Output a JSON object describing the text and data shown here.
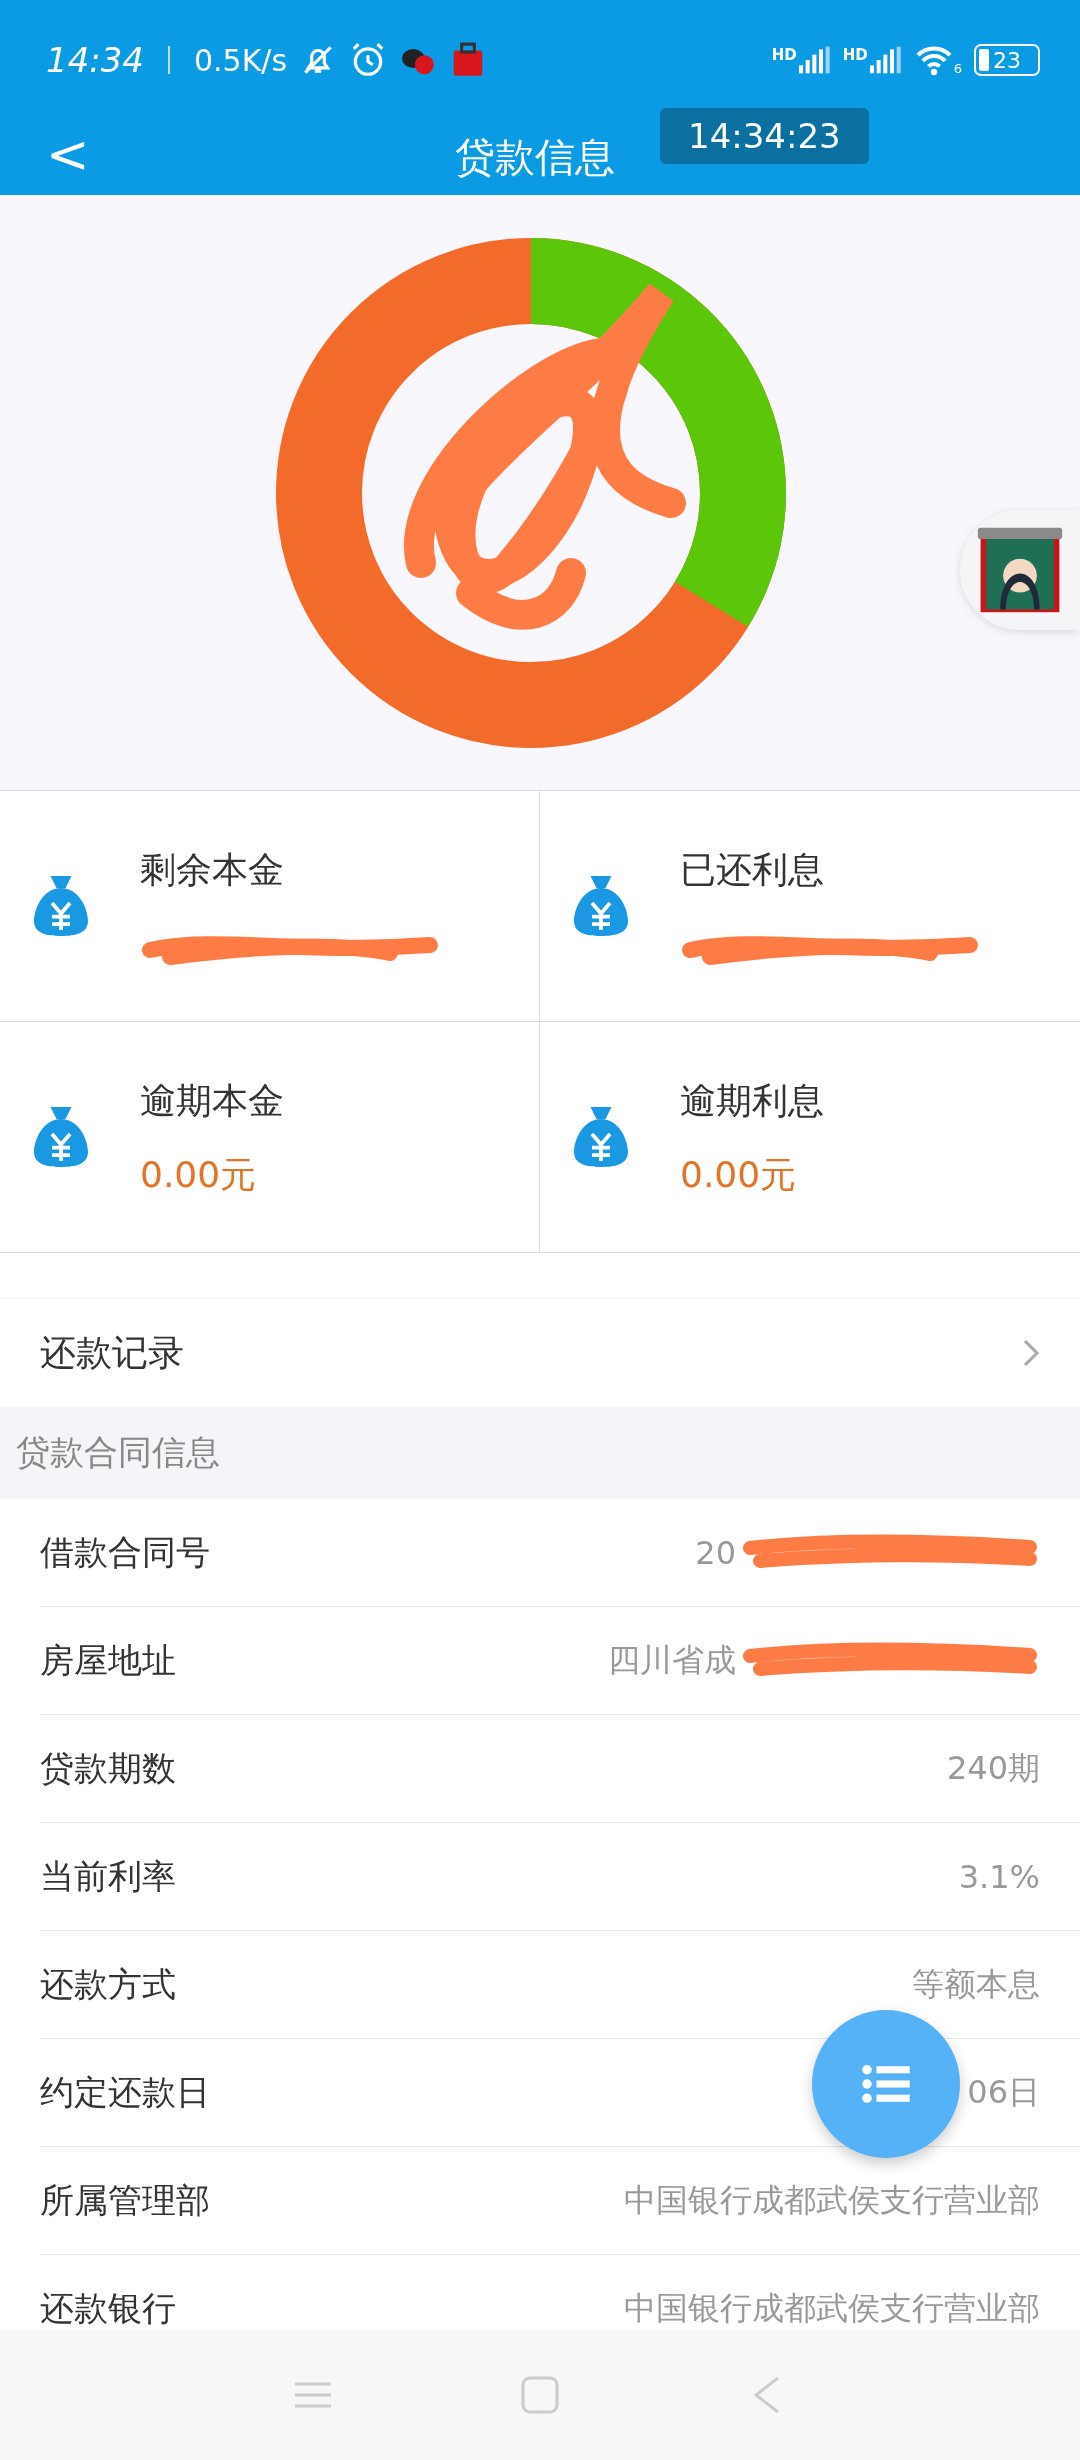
{
  "status_bar": {
    "time": "14:34",
    "speed": "0.5K/s",
    "sim_labels": [
      "HD",
      "HD"
    ],
    "wifi_label": "6",
    "battery": "23"
  },
  "recorder_time": "14:34:23",
  "nav": {
    "back": "<",
    "title": "贷款信息"
  },
  "summary": [
    {
      "label": "剩余本金",
      "redacted": true
    },
    {
      "label": "已还利息",
      "redacted": true
    },
    {
      "label": "逾期本金",
      "value": "0.00元",
      "redacted": false
    },
    {
      "label": "逾期利息",
      "value": "0.00元",
      "redacted": false
    }
  ],
  "record_link": {
    "label": "还款记录"
  },
  "section_title": "贷款合同信息",
  "rows": [
    {
      "label": "借款合同号",
      "value": "20",
      "redacted": true
    },
    {
      "label": "房屋地址",
      "value": "四川省成",
      "redacted": true
    },
    {
      "label": "贷款期数",
      "value": "240期",
      "redacted": false
    },
    {
      "label": "当前利率",
      "value": "3.1%",
      "redacted": false
    },
    {
      "label": "还款方式",
      "value": "等额本息",
      "redacted": false
    },
    {
      "label": "约定还款日",
      "value": "06日",
      "redacted": false
    },
    {
      "label": "所属管理部",
      "value": "中国银行成都武侯支行营业部",
      "redacted": false
    },
    {
      "label": "还款银行",
      "value": "中国银行成都武侯支行营业部",
      "redacted": false
    }
  ]
}
